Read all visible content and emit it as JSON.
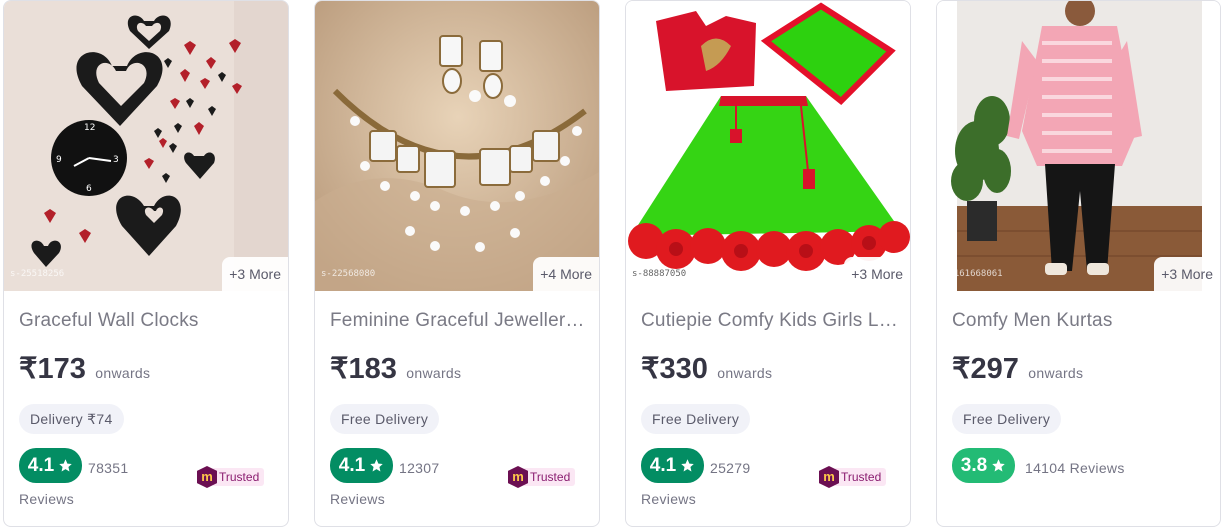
{
  "products": [
    {
      "title": "Graceful Wall Clocks",
      "sku": "s-25518256",
      "more": "+3 More",
      "price": "₹173",
      "price_suffix": "onwards",
      "delivery": "Delivery ₹74",
      "rating": "4.1",
      "reviews_count": "78351",
      "reviews_label": "Reviews",
      "trusted": "Trusted",
      "rating_color": "#038d63"
    },
    {
      "title": "Feminine Graceful Jewellery Sets",
      "sku": "s-22568080",
      "more": "+4 More",
      "price": "₹183",
      "price_suffix": "onwards",
      "delivery": "Free Delivery",
      "rating": "4.1",
      "reviews_count": "12307",
      "reviews_label": "Reviews",
      "trusted": "Trusted",
      "rating_color": "#038d63"
    },
    {
      "title": "Cutiepie Comfy Kids Girls Lehenga",
      "sku": "s-88887050",
      "more": "+3 More",
      "price": "₹330",
      "price_suffix": "onwards",
      "delivery": "Free Delivery",
      "rating": "4.1",
      "reviews_count": "25279",
      "reviews_label": "Reviews",
      "trusted": "Trusted",
      "rating_color": "#038d63"
    },
    {
      "title": "Comfy Men Kurtas",
      "sku": "s-161668061",
      "more": "+3 More",
      "price": "₹297",
      "price_suffix": "onwards",
      "delivery": "Free Delivery",
      "rating": "3.8",
      "reviews_inline": "14104 Reviews",
      "rating_color": "#23bb75"
    }
  ],
  "icons": {
    "star": "star-icon",
    "trusted_badge": "meesho-m-icon"
  }
}
